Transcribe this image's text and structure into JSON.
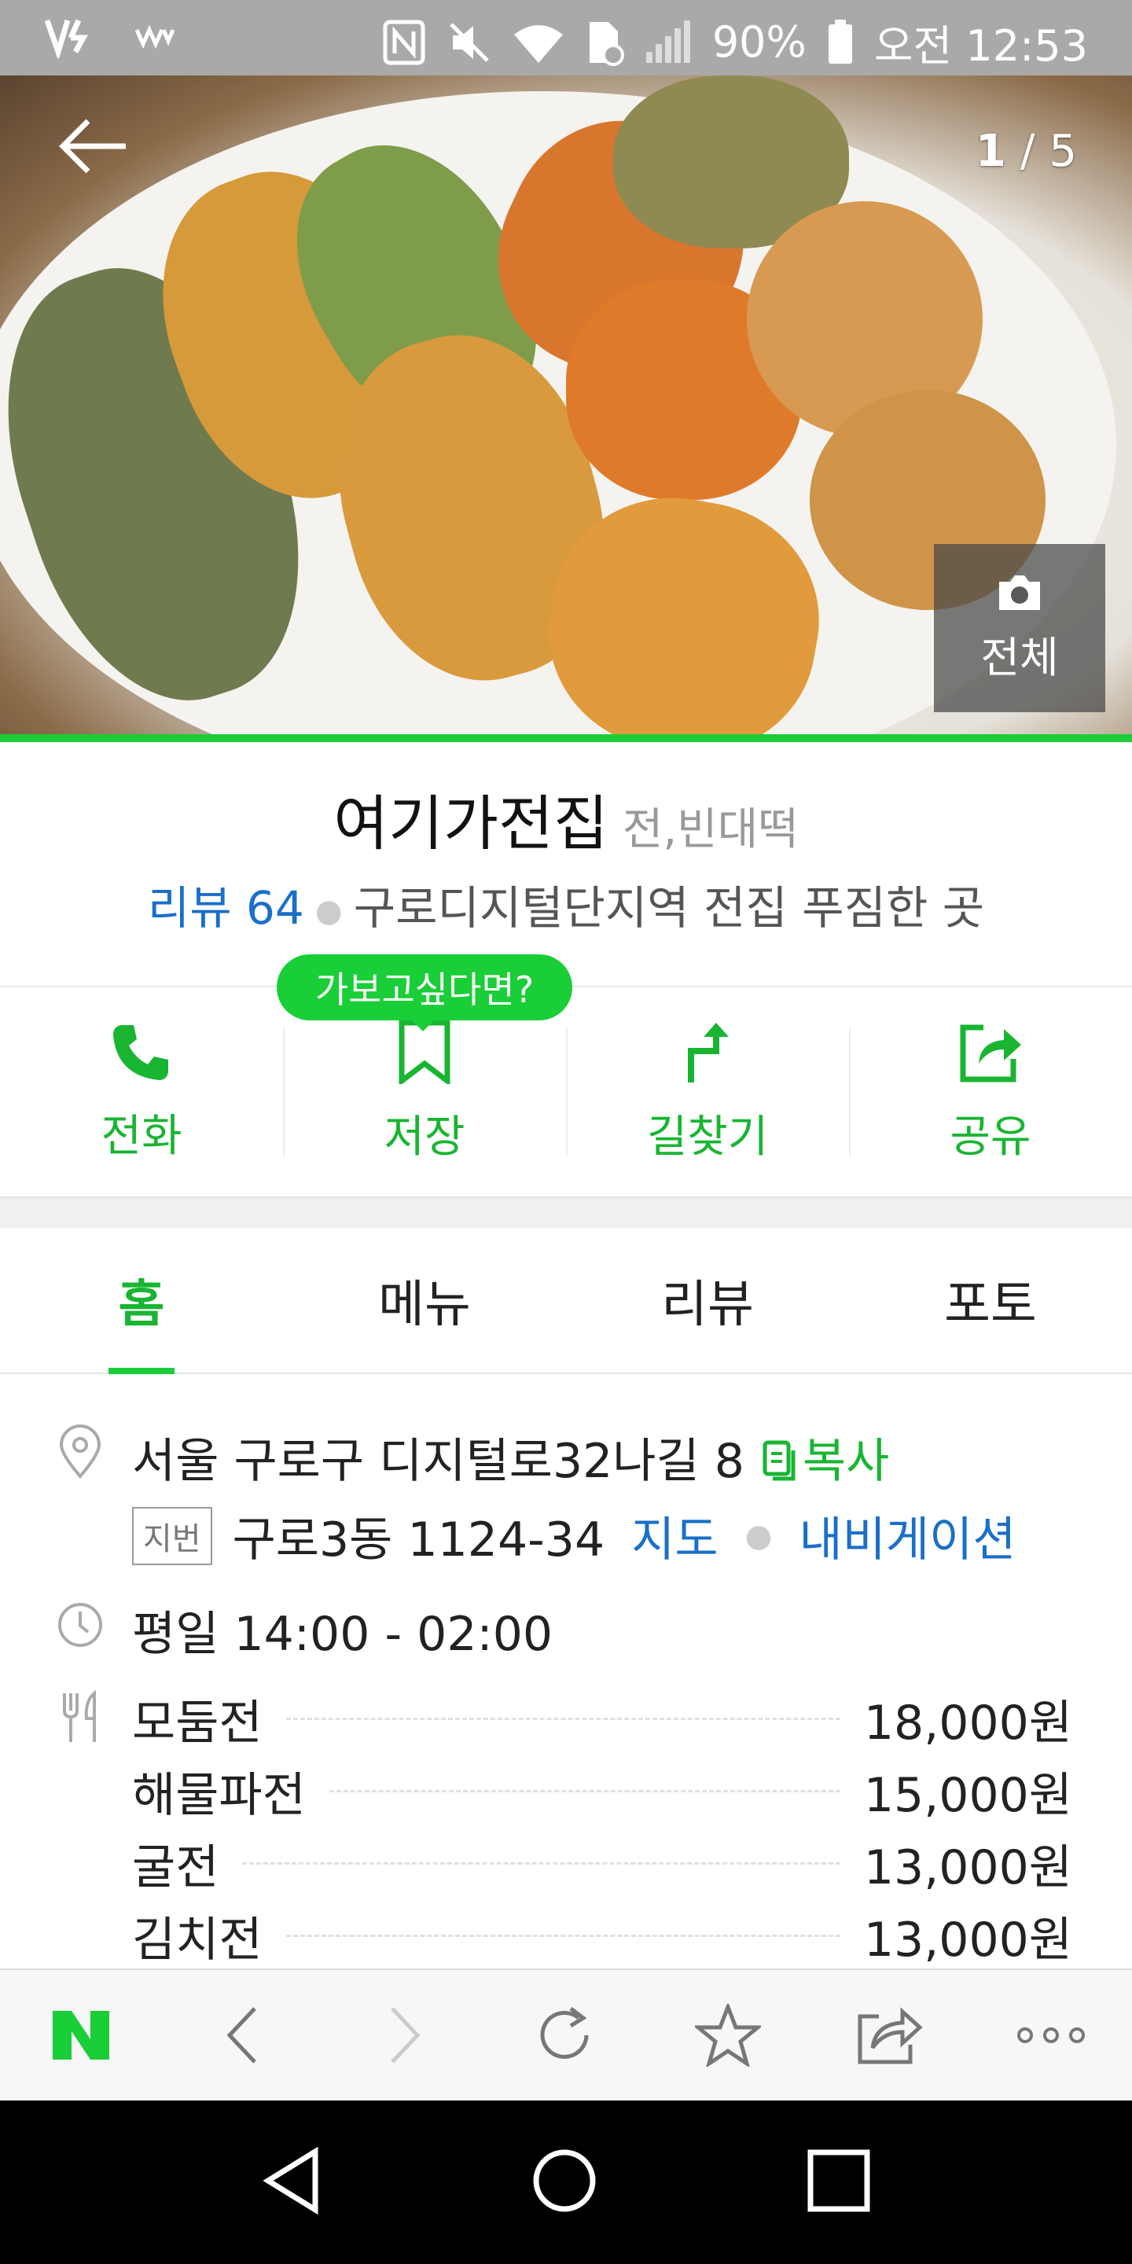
{
  "status_bar": {
    "battery": "90%",
    "time": "오전 12:53"
  },
  "hero": {
    "counter_current": "1",
    "counter_total": "/ 5",
    "all_photos_label": "전체"
  },
  "place": {
    "name": "여기가전집",
    "category": "전,빈대떡",
    "reviews": "리뷰 64",
    "description": "구로디지털단지역 전집 푸짐한 곳"
  },
  "actions": {
    "tooltip": "가보고싶다면?",
    "items": [
      {
        "label": "전화",
        "icon": "phone-icon"
      },
      {
        "label": "저장",
        "icon": "bookmark-icon"
      },
      {
        "label": "길찾기",
        "icon": "directions-icon"
      },
      {
        "label": "공유",
        "icon": "share-icon"
      }
    ]
  },
  "tabs": [
    {
      "label": "홈",
      "active": true
    },
    {
      "label": "메뉴",
      "active": false
    },
    {
      "label": "리뷰",
      "active": false
    },
    {
      "label": "포토",
      "active": false
    }
  ],
  "info": {
    "address": "서울 구로구 디지털로32나길 8",
    "copy_label": "복사",
    "lot_badge": "지번",
    "lot_address": "구로3동 1124-34",
    "map_link": "지도",
    "navigation_link": "내비게이션",
    "hours": "평일 14:00 - 02:00"
  },
  "menu": [
    {
      "name": "모둠전",
      "price": "18,000원"
    },
    {
      "name": "해물파전",
      "price": "15,000원"
    },
    {
      "name": "굴전",
      "price": "13,000원"
    },
    {
      "name": "김치전",
      "price": "13,000원"
    }
  ],
  "colors": {
    "accent_green": "#19ce36",
    "link_blue": "#1a6fc9"
  }
}
